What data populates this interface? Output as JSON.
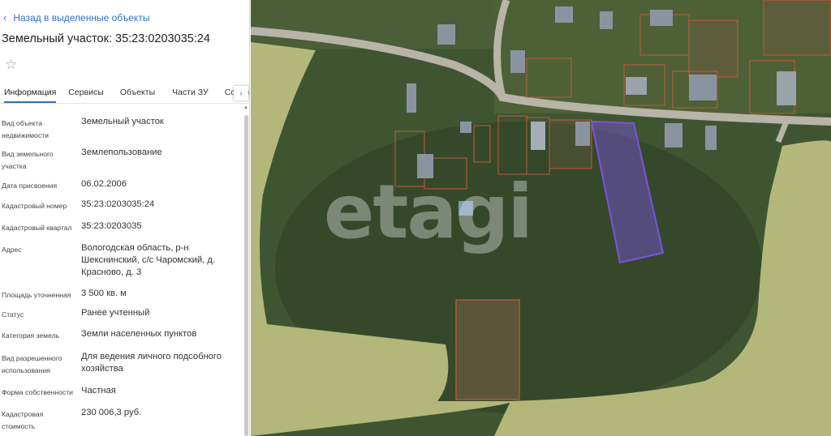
{
  "panel": {
    "back_label": "Назад в выделенные объекты",
    "title": "Земельный участок: 35:23:0203035:24",
    "tabs": [
      "Информация",
      "Сервисы",
      "Объекты",
      "Части ЗУ",
      "Состав"
    ],
    "active_tab": "Информация",
    "fields": [
      {
        "label": "Вид объекта недвижимости",
        "value": "Земельный участок"
      },
      {
        "label": "Вид земельного участка",
        "value": "Землепользование"
      },
      {
        "label": "Дата присвоения",
        "value": "06.02.2006"
      },
      {
        "label": "Кадастровый номер",
        "value": "35:23:0203035:24"
      },
      {
        "label": "Кадастровый квартал",
        "value": "35:23:0203035"
      },
      {
        "label": "Адрес",
        "value": "Вологодская область, р-н Шекснинский, с/с Чаромский, д. Красново, д. 3"
      },
      {
        "label": "Площадь уточненная",
        "value": "3 500 кв. м"
      },
      {
        "label": "Статус",
        "value": "Ранее учтенный"
      },
      {
        "label": "Категория земель",
        "value": "Земли населенных пунктов"
      },
      {
        "label": "Вид разрешенного использования",
        "value": "Для ведения личного подсобного хозяйства"
      },
      {
        "label": "Форма собственности",
        "value": "Частная"
      },
      {
        "label": "Кадастровая стоимость",
        "value": "230 006,3 руб."
      }
    ]
  },
  "map": {
    "watermark": "etagi",
    "colors": {
      "vegetation": "#3f5532",
      "zone_fill": "#c8c987",
      "parcel_outline": "#c45a3a",
      "selected_parcel": "#7a52e0",
      "road": "#b8b4a8"
    }
  }
}
